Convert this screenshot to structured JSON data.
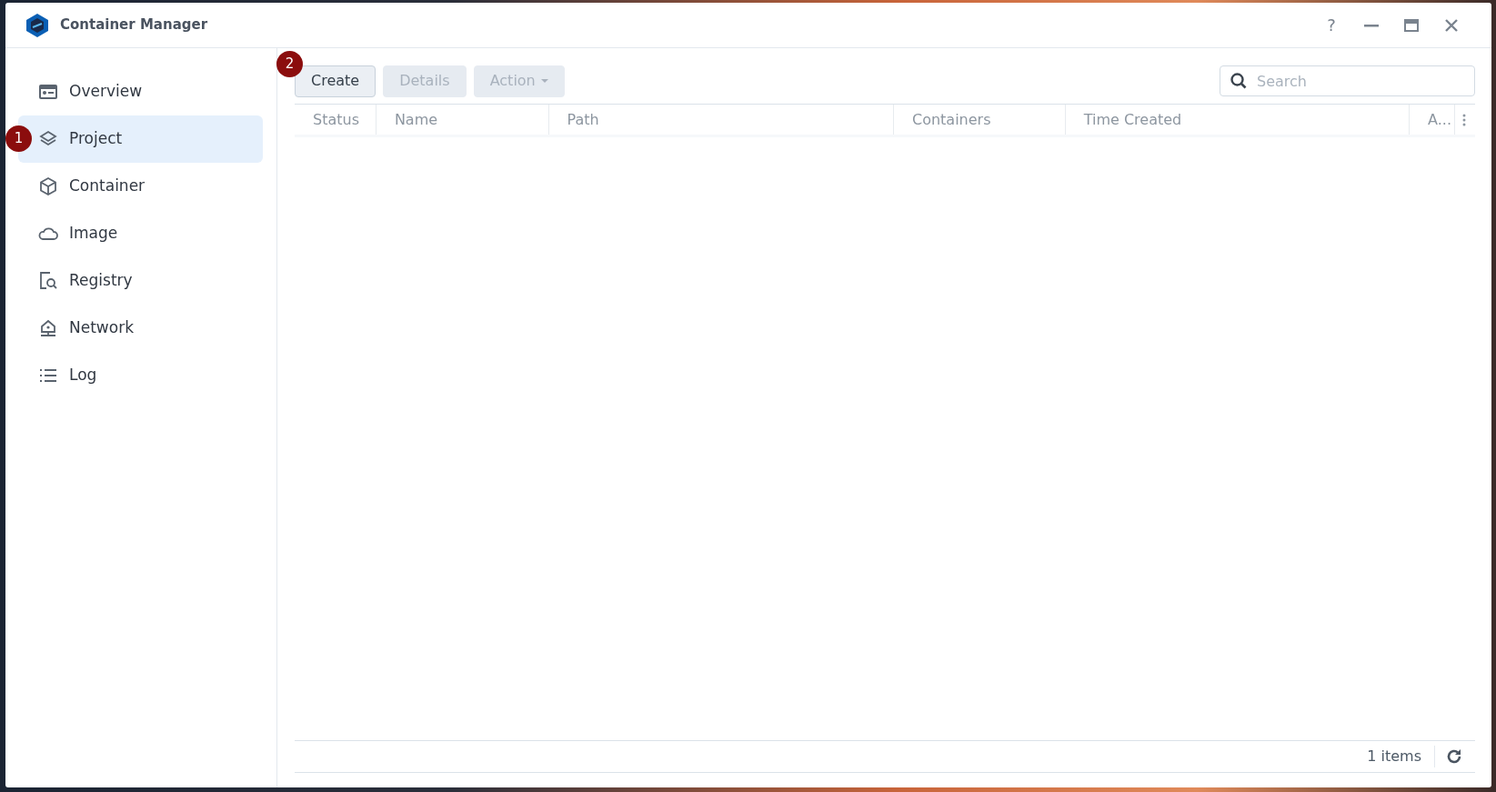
{
  "window": {
    "title": "Container Manager"
  },
  "title_bar_buttons": [
    {
      "kind": "help",
      "label": "?"
    },
    {
      "kind": "minimize"
    },
    {
      "kind": "maximize"
    },
    {
      "kind": "close"
    }
  ],
  "sidebar": {
    "items": [
      {
        "label": "Overview",
        "kind": "overview",
        "selected": false
      },
      {
        "label": "Project",
        "kind": "project",
        "selected": true,
        "marker": "1"
      },
      {
        "label": "Container",
        "kind": "container",
        "selected": false
      },
      {
        "label": "Image",
        "kind": "image",
        "selected": false
      },
      {
        "label": "Registry",
        "kind": "registry",
        "selected": false
      },
      {
        "label": "Network",
        "kind": "network",
        "selected": false
      },
      {
        "label": "Log",
        "kind": "log",
        "selected": false
      }
    ]
  },
  "toolbar": {
    "buttons": [
      {
        "label": "Create",
        "kind": "plain",
        "disabled": false,
        "marker": "2"
      },
      {
        "label": "Details",
        "kind": "plain",
        "disabled": true
      },
      {
        "label": "Action",
        "kind": "dropdown",
        "disabled": true
      }
    ],
    "search": {
      "placeholder": "Search"
    }
  },
  "table": {
    "columns": [
      "Status",
      "Name",
      "Path",
      "Containers",
      "Time Created",
      "A..."
    ]
  },
  "status_bar": {
    "count": "1 items"
  }
}
